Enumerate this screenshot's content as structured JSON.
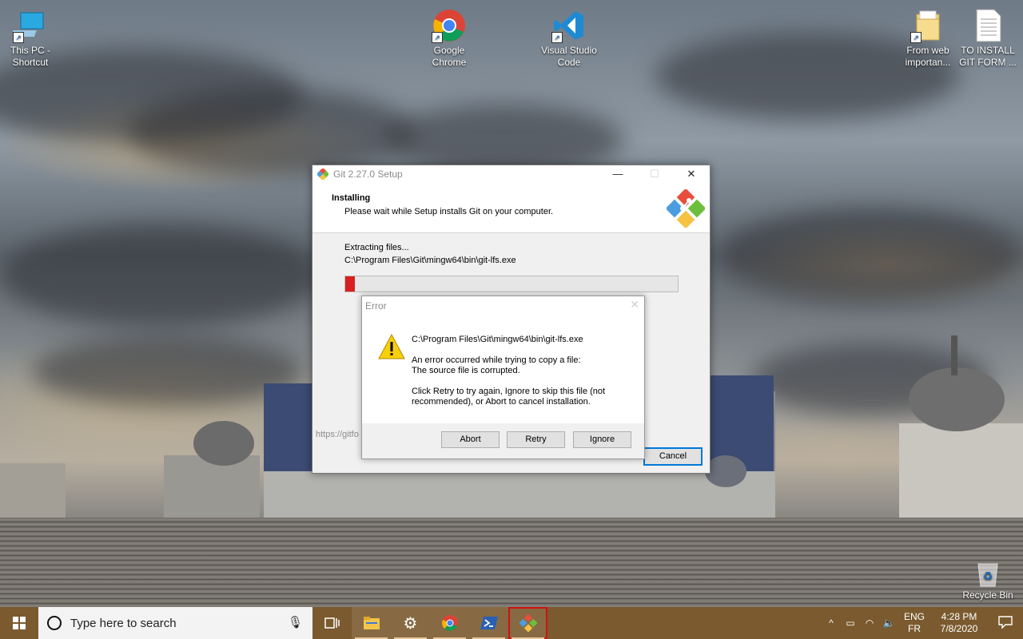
{
  "desktop": {
    "icons": [
      {
        "label": "This PC -\nShortcut",
        "icon": "this-pc-icon"
      },
      {
        "label": "Google\nChrome",
        "icon": "chrome-icon"
      },
      {
        "label": "Visual Studio\nCode",
        "icon": "vscode-icon"
      },
      {
        "label": "From web\nimportan...",
        "icon": "folder-icon"
      },
      {
        "label": "TO INSTALL\nGIT FORM ...",
        "icon": "document-icon"
      },
      {
        "label": "Recycle Bin",
        "icon": "recycle-bin-icon"
      }
    ]
  },
  "setup_window": {
    "title": "Git 2.27.0 Setup",
    "header_title": "Installing",
    "header_subtitle": "Please wait while Setup installs Git on your computer.",
    "status_text": "Extracting files...",
    "current_path": "C:\\Program Files\\Git\\mingw64\\bin\\git-lfs.exe",
    "progress_fraction": 0.03,
    "url_text": "https://gitfo",
    "cancel_label": "Cancel"
  },
  "error_dialog": {
    "title": "Error",
    "file_path": "C:\\Program Files\\Git\\mingw64\\bin\\git-lfs.exe",
    "message_line1": "An error occurred while trying to copy a file:",
    "message_line2": "The source file is corrupted.",
    "instructions": "Click Retry to try again, Ignore to skip this file (not recommended), or Abort to cancel installation.",
    "buttons": {
      "abort": "Abort",
      "retry": "Retry",
      "ignore": "Ignore"
    }
  },
  "taskbar": {
    "search_placeholder": "Type here to search",
    "language_line1": "ENG",
    "language_line2": "FR",
    "time": "4:28 PM",
    "date": "7/8/2020",
    "accent_color": "#7a5a2e"
  }
}
